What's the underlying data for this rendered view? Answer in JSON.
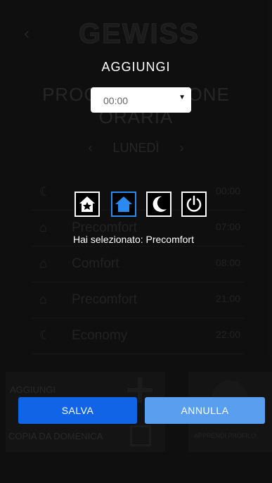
{
  "background": {
    "back_glyph": "‹",
    "logo_text": "GEWISS",
    "title_line1": "PROGRAMMAZIONE",
    "title_line2": "ORARIA",
    "day_prev": "‹",
    "day_label": "LUNEDÌ",
    "day_next": "›",
    "schedule": [
      {
        "icon": "moon-icon",
        "label": "",
        "time": "00:00"
      },
      {
        "icon": "home-icon",
        "label": "Precomfort",
        "time": "07:00"
      },
      {
        "icon": "home-comfort-icon",
        "label": "Comfort",
        "time": "08:00"
      },
      {
        "icon": "home-icon",
        "label": "Precomfort",
        "time": "21:00"
      },
      {
        "icon": "moon-icon",
        "label": "Economy",
        "time": "22:00"
      }
    ],
    "add_label": "AGGIUNGI",
    "copy_label": "COPIA DA DOMENICA",
    "learn_label": "APPRENDI PROFILO"
  },
  "modal": {
    "title": "AGGIUNGI",
    "time_value": "00:00",
    "time_caret": "▼",
    "modes": [
      {
        "name": "comfort-icon",
        "selected": false
      },
      {
        "name": "precomfort-icon",
        "selected": true
      },
      {
        "name": "economy-moon-icon",
        "selected": false
      },
      {
        "name": "off-power-icon",
        "selected": false
      }
    ],
    "selection_text": "Hai selezionato: Precomfort",
    "save_label": "SALVA",
    "cancel_label": "ANNULLA",
    "colors": {
      "accent_blue": "#1264e6",
      "cancel_blue": "#5a9ef0",
      "selected_border": "#2a8af0"
    }
  }
}
